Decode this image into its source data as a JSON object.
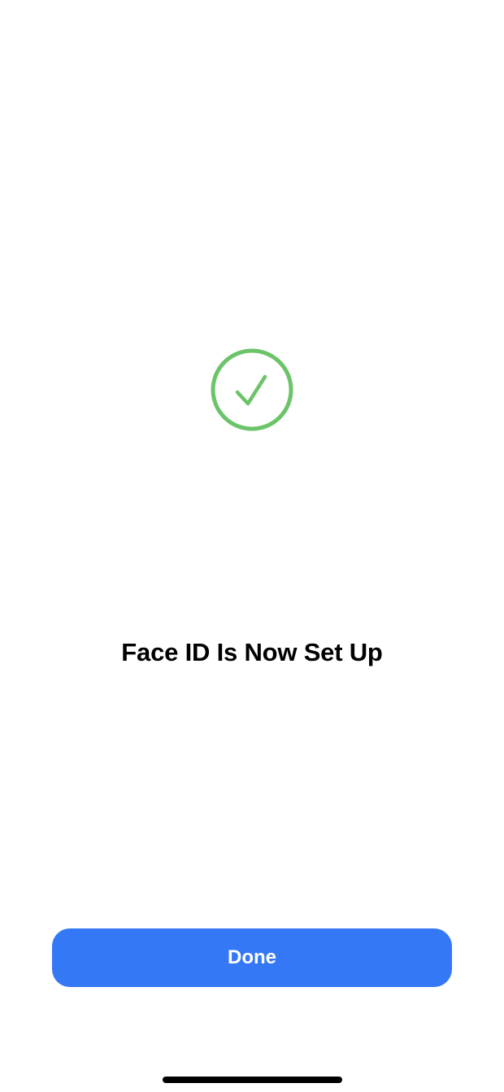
{
  "icon": {
    "name": "checkmark-circle-icon",
    "color": "#6CC46A"
  },
  "title": "Face ID Is Now Set Up",
  "done_button": {
    "label": "Done",
    "color": "#3478F6"
  }
}
